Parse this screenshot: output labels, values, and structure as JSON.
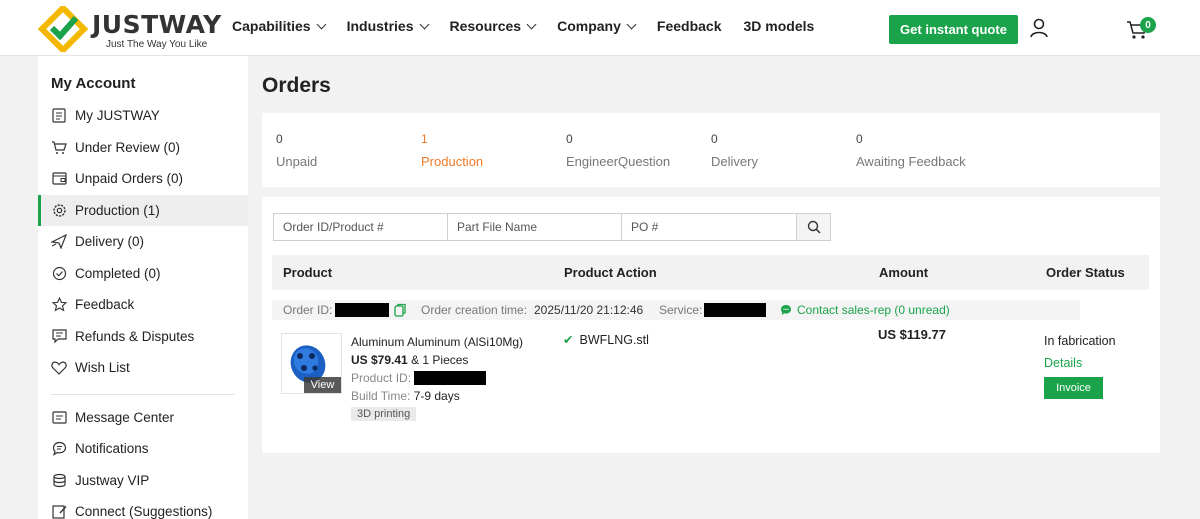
{
  "brand": {
    "name": "JUSTWAY",
    "tagline": "Just The Way You Like",
    "accent_color": "#1aa34a",
    "highlight_color": "#f07a26",
    "logo_colors": [
      "#f5b800",
      "#1aa34a"
    ]
  },
  "header": {
    "nav": [
      {
        "label": "Capabilities",
        "has_dropdown": true
      },
      {
        "label": "Industries",
        "has_dropdown": true
      },
      {
        "label": "Resources",
        "has_dropdown": true
      },
      {
        "label": "Company",
        "has_dropdown": true
      },
      {
        "label": "Feedback",
        "has_dropdown": false
      },
      {
        "label": "3D models",
        "has_dropdown": false
      }
    ],
    "quote_button": "Get instant quote",
    "cart_count": "0",
    "icons": [
      "user-icon",
      "cart-icon"
    ]
  },
  "sidebar": {
    "title": "My Account",
    "items": [
      {
        "label": "My JUSTWAY",
        "icon": "profile-card-icon"
      },
      {
        "label": "Under Review (0)",
        "icon": "cart-icon"
      },
      {
        "label": "Unpaid Orders (0)",
        "icon": "wallet-icon"
      },
      {
        "label": "Production (1)",
        "icon": "gear-icon",
        "active": true
      },
      {
        "label": "Delivery (0)",
        "icon": "plane-icon"
      },
      {
        "label": "Completed (0)",
        "icon": "check-circle-icon"
      },
      {
        "label": "Feedback",
        "icon": "star-icon"
      },
      {
        "label": "Refunds & Disputes",
        "icon": "chat-alert-icon"
      },
      {
        "label": "Wish List",
        "icon": "heart-icon"
      },
      {
        "label": "Message Center",
        "icon": "message-icon"
      },
      {
        "label": "Notifications",
        "icon": "chat-bubble-icon"
      },
      {
        "label": "Justway VIP",
        "icon": "coins-icon"
      },
      {
        "label": "Connect (Suggestions)",
        "icon": "edit-icon"
      }
    ]
  },
  "main": {
    "title": "Orders",
    "stats": [
      {
        "count": "0",
        "label": "Unpaid"
      },
      {
        "count": "1",
        "label": "Production",
        "active": true
      },
      {
        "count": "0",
        "label": "EngineerQuestion"
      },
      {
        "count": "0",
        "label": "Delivery"
      },
      {
        "count": "0",
        "label": "Awaiting Feedback"
      }
    ],
    "search": {
      "order_placeholder": "Order ID/Product #",
      "file_placeholder": "Part File Name",
      "po_placeholder": "PO #"
    },
    "table_headers": [
      "Product",
      "Product Action",
      "Amount",
      "Order Status"
    ],
    "order": {
      "id_label": "Order ID:",
      "created_label": "Order creation time:",
      "created_value": "2025/11/20 21:12:46",
      "service_label": "Service:",
      "contact": "Contact sales-rep (0 unread)",
      "product_name": "Aluminum Aluminum (AlSi10Mg)",
      "price": "US $79.41",
      "quantity": "& 1 Pieces",
      "product_id_label": "Product ID:",
      "build_time_label": "Build Time:",
      "build_time_value": "7-9 days",
      "process_tag": "3D printing",
      "view_label": "View",
      "file_name": "BWFLNG.stl",
      "amount": "US $119.77",
      "status": "In fabrication",
      "details": "Details",
      "invoice": "Invoice"
    }
  }
}
